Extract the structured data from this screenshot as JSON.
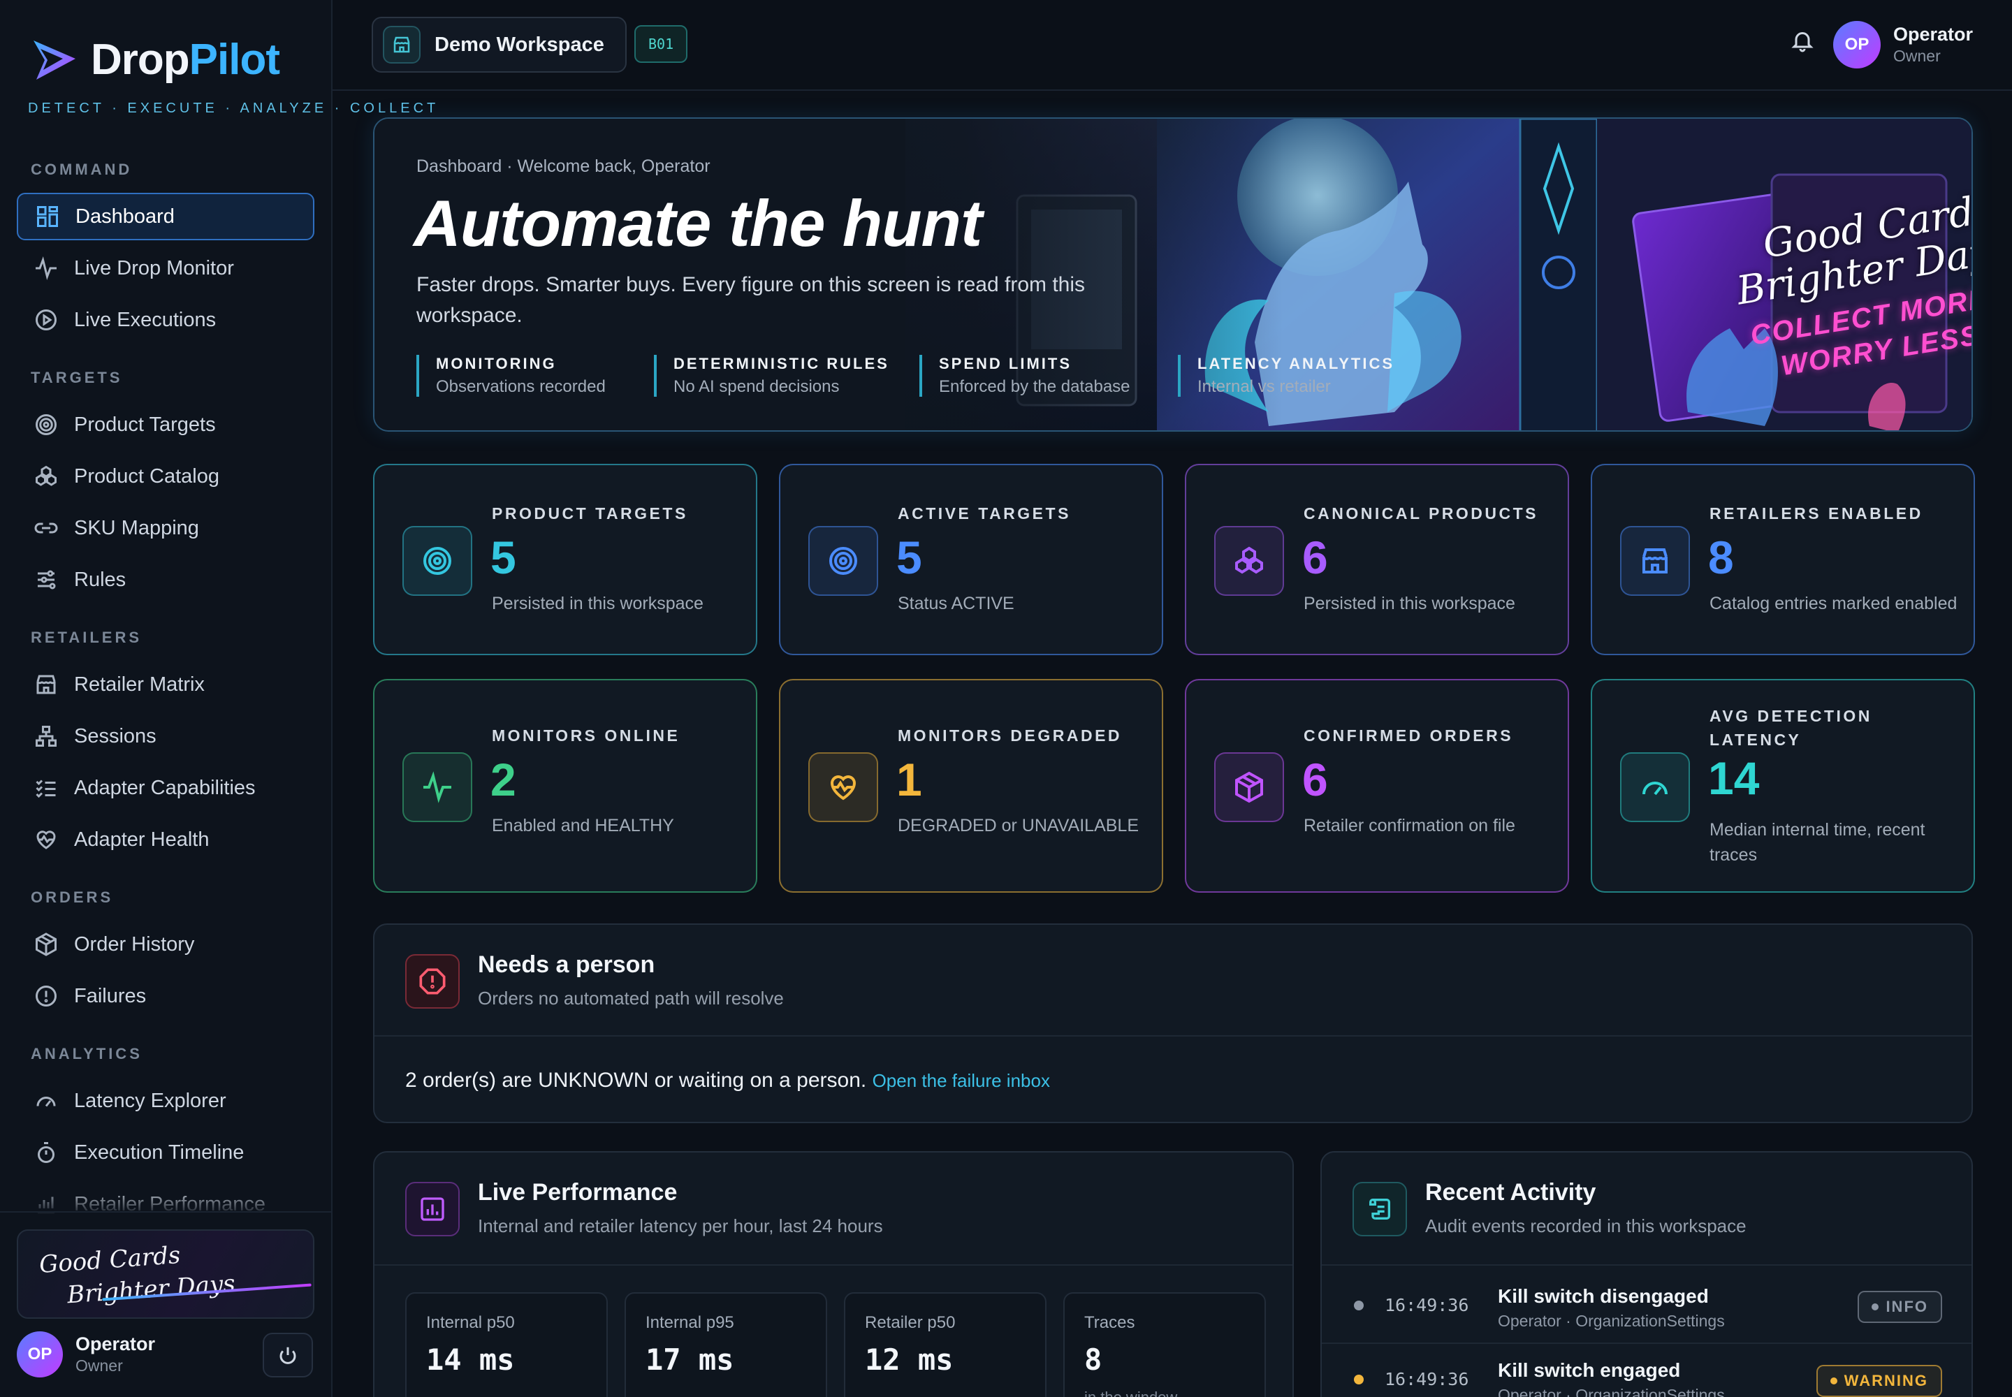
{
  "brand": {
    "name_part1": "Drop",
    "name_part2": "Pilot",
    "tagline": "DETECT · EXECUTE · ANALYZE · COLLECT",
    "accent": "#3cb4ff"
  },
  "sidebar": {
    "sections": [
      {
        "label": "COMMAND",
        "items": [
          {
            "label": "Dashboard",
            "icon": "grid-icon",
            "active": true
          },
          {
            "label": "Live Drop Monitor",
            "icon": "pulse-icon"
          },
          {
            "label": "Live Executions",
            "icon": "play-circle-icon"
          }
        ]
      },
      {
        "label": "TARGETS",
        "items": [
          {
            "label": "Product Targets",
            "icon": "target-icon"
          },
          {
            "label": "Product Catalog",
            "icon": "boxes-icon"
          },
          {
            "label": "SKU Mapping",
            "icon": "link-icon"
          },
          {
            "label": "Rules",
            "icon": "sliders-icon"
          }
        ]
      },
      {
        "label": "RETAILERS",
        "items": [
          {
            "label": "Retailer Matrix",
            "icon": "store-icon"
          },
          {
            "label": "Sessions",
            "icon": "network-icon"
          },
          {
            "label": "Adapter Capabilities",
            "icon": "checklist-icon"
          },
          {
            "label": "Adapter Health",
            "icon": "heart-pulse-icon"
          }
        ]
      },
      {
        "label": "ORDERS",
        "items": [
          {
            "label": "Order History",
            "icon": "package-icon"
          },
          {
            "label": "Failures",
            "icon": "alert-circle-icon"
          }
        ]
      },
      {
        "label": "ANALYTICS",
        "items": [
          {
            "label": "Latency Explorer",
            "icon": "gauge-icon"
          },
          {
            "label": "Execution Timeline",
            "icon": "timer-icon"
          },
          {
            "label": "Retailer Performance",
            "icon": "bar-chart-icon"
          }
        ]
      }
    ],
    "promo": {
      "line1": "Good Cards",
      "line2": "Brighter Days"
    },
    "user": {
      "initials": "OP",
      "name": "Operator",
      "role": "Owner"
    }
  },
  "topbar": {
    "workspace": "Demo Workspace",
    "workspace_code": "B01",
    "user": {
      "initials": "OP",
      "name": "Operator",
      "role": "Owner"
    }
  },
  "hero": {
    "breadcrumb": "Dashboard · Welcome back, Operator",
    "title": "Automate the hunt",
    "subtitle": "Faster drops. Smarter buys. Every figure on this screen is read from this workspace.",
    "pillars": [
      {
        "title": "MONITORING",
        "desc": "Observations recorded"
      },
      {
        "title": "DETERMINISTIC RULES",
        "desc": "No AI spend decisions"
      },
      {
        "title": "SPEND LIMITS",
        "desc": "Enforced by the database"
      },
      {
        "title": "LATENCY ANALYTICS",
        "desc": "Internal vs retailer"
      }
    ],
    "art_script_1": "Good Cards",
    "art_script_2": "Brighter Days",
    "art_pink_1": "COLLECT MORE",
    "art_pink_2": "WORRY LESS"
  },
  "stats": [
    {
      "label": "PRODUCT TARGETS",
      "value": "5",
      "desc": "Persisted in this workspace",
      "color": "#34c7e0",
      "icon": "target-icon"
    },
    {
      "label": "ACTIVE TARGETS",
      "value": "5",
      "desc": "Status ACTIVE",
      "color": "#4b8cff",
      "icon": "target-icon"
    },
    {
      "label": "CANONICAL PRODUCTS",
      "value": "6",
      "desc": "Persisted in this workspace",
      "color": "#a85cff",
      "icon": "boxes-icon"
    },
    {
      "label": "RETAILERS ENABLED",
      "value": "8",
      "desc": "Catalog entries marked enabled",
      "color": "#4b8cff",
      "icon": "store-icon"
    },
    {
      "label": "MONITORS ONLINE",
      "value": "2",
      "desc": "Enabled and HEALTHY",
      "color": "#3ed08a",
      "icon": "pulse-icon"
    },
    {
      "label": "MONITORS DEGRADED",
      "value": "1",
      "desc": "DEGRADED or UNAVAILABLE",
      "color": "#f3b63c",
      "icon": "heart-pulse-icon"
    },
    {
      "label": "CONFIRMED ORDERS",
      "value": "6",
      "desc": "Retailer confirmation on file",
      "color": "#c054ff",
      "icon": "package-icon"
    },
    {
      "label": "AVG DETECTION LATENCY",
      "value": "14",
      "desc": "Median internal time, recent traces",
      "color": "#2fd6d2",
      "icon": "gauge-icon"
    }
  ],
  "needs_person": {
    "title": "Needs a person",
    "subtitle": "Orders no automated path will resolve",
    "message": "2 order(s) are UNKNOWN or waiting on a person.",
    "link": "Open the failure inbox"
  },
  "performance": {
    "title": "Live Performance",
    "subtitle": "Internal and retailer latency per hour, last 24 hours",
    "metrics": [
      {
        "label": "Internal p50",
        "value": "14 ms",
        "sub": ""
      },
      {
        "label": "Internal p95",
        "value": "17 ms",
        "sub": ""
      },
      {
        "label": "Retailer p50",
        "value": "12 ms",
        "sub": ""
      },
      {
        "label": "Traces",
        "value": "8",
        "sub": "in the window"
      }
    ]
  },
  "activity": {
    "title": "Recent Activity",
    "subtitle": "Audit events recorded in this workspace",
    "rows": [
      {
        "time": "16:49:36",
        "event": "Kill switch disengaged",
        "source": "Operator · OrganizationSettings",
        "tag": "INFO",
        "color": "#8e98a6"
      },
      {
        "time": "16:49:36",
        "event": "Kill switch engaged",
        "source": "Operator · OrganizationSettings",
        "tag": "WARNING",
        "color": "#f3b63c"
      }
    ]
  }
}
